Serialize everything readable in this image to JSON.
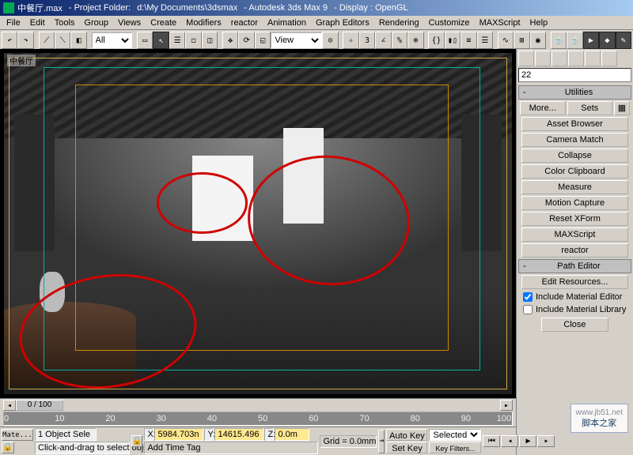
{
  "title": {
    "file": "中餐厅.max",
    "proj_label": "- Project Folder:",
    "proj_path": "d:\\My Documents\\3dsmax",
    "app": "- Autodesk 3ds Max 9",
    "display": "- Display : OpenGL"
  },
  "menu": [
    "File",
    "Edit",
    "Tools",
    "Group",
    "Views",
    "Create",
    "Modifiers",
    "reactor",
    "Animation",
    "Graph Editors",
    "Rendering",
    "Customize",
    "MAXScript",
    "Help"
  ],
  "toolbar": {
    "sel_filter": "All",
    "view_label": "View"
  },
  "viewport": {
    "label": "中餐厅"
  },
  "side": {
    "input_value": "22",
    "rollout_utilities": "Utilities",
    "more": "More...",
    "sets": "Sets",
    "btns": [
      "Asset Browser",
      "Camera Match",
      "Collapse",
      "Color Clipboard",
      "Measure",
      "Motion Capture",
      "Reset XForm",
      "MAXScript",
      "reactor"
    ],
    "rollout_path": "Path Editor",
    "edit_res": "Edit Resources...",
    "chk1": "Include Material Editor",
    "chk2": "Include Material Library",
    "close": "Close"
  },
  "timeline": {
    "thumb": "0 / 100",
    "ticks": [
      "0",
      "10",
      "20",
      "30",
      "40",
      "50",
      "60",
      "70",
      "80",
      "90",
      "100"
    ]
  },
  "status": {
    "sel": "1 Object Sele",
    "mate": "Mate...",
    "xl": "X:",
    "xv": "5984.703n",
    "yl": "Y:",
    "yv": "14615.496",
    "zl": "Z:",
    "zv": "0.0m",
    "grid": "Grid = 0.0mm",
    "autokey": "Auto Key",
    "setkey": "Set Key",
    "selected": "Selected",
    "keyfilters": "Key Filters...",
    "addtag": "Add Time Tag",
    "hint": "Click-and-drag to select objects"
  },
  "watermark": {
    "site": "脚本之家",
    "url": "www.jb51.net"
  }
}
